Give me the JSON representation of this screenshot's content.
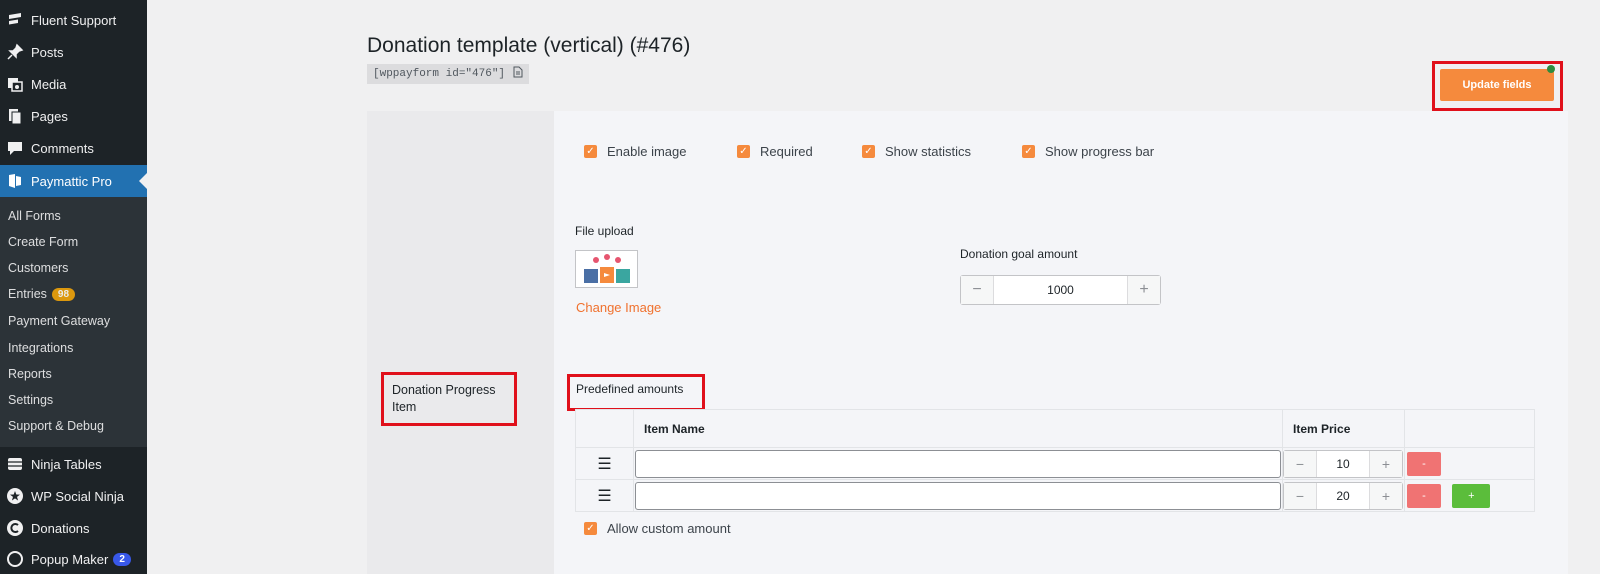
{
  "sidebar": {
    "top_items": [
      {
        "label": "Fluent Support",
        "icon": "fluent-support-icon"
      },
      {
        "label": "Posts",
        "icon": "pin-icon"
      },
      {
        "label": "Media",
        "icon": "media-icon"
      },
      {
        "label": "Pages",
        "icon": "pages-icon"
      },
      {
        "label": "Comments",
        "icon": "comment-icon"
      },
      {
        "label": "Paymattic Pro",
        "icon": "paymattic-icon"
      }
    ],
    "sub_items": [
      {
        "label": "All Forms"
      },
      {
        "label": "Create Form"
      },
      {
        "label": "Customers"
      },
      {
        "label": "Entries",
        "badge": "98"
      },
      {
        "label": "Payment Gateway"
      },
      {
        "label": "Integrations"
      },
      {
        "label": "Reports"
      },
      {
        "label": "Settings"
      },
      {
        "label": "Support & Debug"
      }
    ],
    "bottom_items": [
      {
        "label": "Ninja Tables",
        "icon": "table-icon"
      },
      {
        "label": "WP Social Ninja",
        "icon": "star-icon"
      },
      {
        "label": "Donations",
        "icon": "donation-icon"
      },
      {
        "label": "Popup Maker",
        "icon": "popup-icon",
        "badge": "2"
      }
    ]
  },
  "page": {
    "title": "Donation template (vertical) (#476)",
    "shortcode": "[wppayform id=\"476\"]",
    "update_button": "Update fields"
  },
  "field": {
    "section_label": "Donation Progress Item",
    "options": [
      {
        "label": "Enable image",
        "checked": true
      },
      {
        "label": "Required",
        "checked": true
      },
      {
        "label": "Show statistics",
        "checked": true
      },
      {
        "label": "Show progress bar",
        "checked": true
      }
    ],
    "file_upload_label": "File upload",
    "change_image": "Change Image",
    "goal_label": "Donation goal amount",
    "goal_value": "1000",
    "predefined_label": "Predefined amounts",
    "table_headers": {
      "name": "Item Name",
      "price": "Item Price"
    },
    "rows": [
      {
        "name": "",
        "price": "10",
        "minus": "-"
      },
      {
        "name": "",
        "price": "20",
        "minus": "-",
        "plus": "+"
      }
    ],
    "allow_custom_label": "Allow custom amount",
    "allow_custom_checked": true
  },
  "colors": {
    "accent": "#f58a3d",
    "highlight": "#e0101b",
    "sidebar": "#1d2327",
    "active_menu": "#2271b1"
  }
}
